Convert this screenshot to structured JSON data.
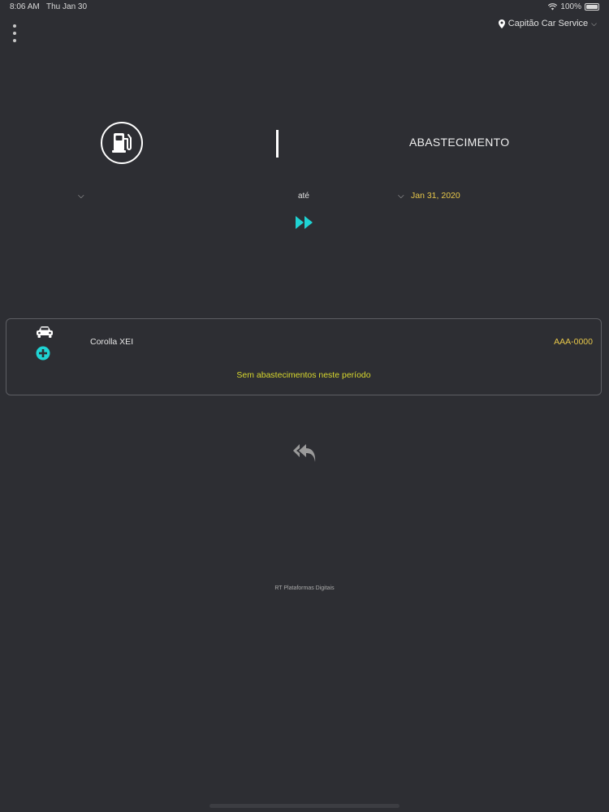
{
  "status_bar": {
    "time": "8:06 AM",
    "date": "Thu Jan 30",
    "battery": "100%"
  },
  "location": {
    "name": "Capitão Car Service"
  },
  "header": {
    "title": "ABASTECIMENTO"
  },
  "date_filter": {
    "separator": "até",
    "end_date": "Jan 31, 2020"
  },
  "vehicle": {
    "name": "Corolla XEI",
    "plate": "AAA-0000",
    "empty_message": "Sem abastecimentos neste período"
  },
  "footer": {
    "credit": "RT Plataformas Digitais"
  },
  "colors": {
    "background": "#2d2e33",
    "accent": "#1fd3d3",
    "highlight": "#e8c84a",
    "empty_text": "#d8d82e"
  },
  "icons": {
    "fuel": "fuel-pump-icon",
    "car": "car-icon",
    "add": "plus-circle-icon",
    "go": "fast-forward-icon",
    "back": "reply-all-icon",
    "location": "map-pin-icon"
  }
}
